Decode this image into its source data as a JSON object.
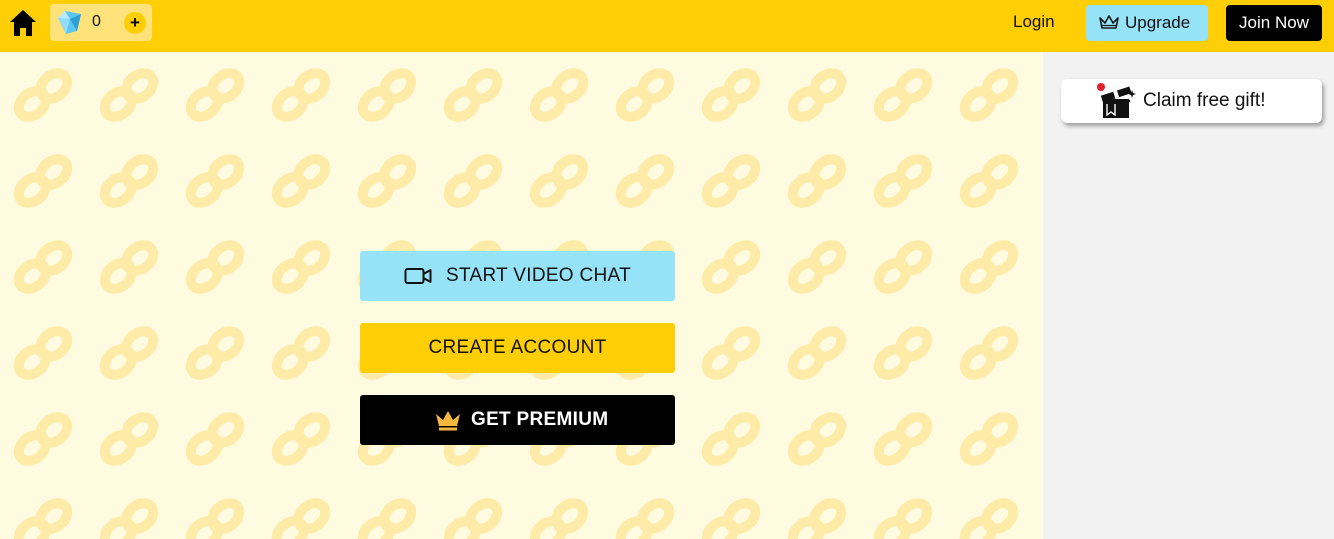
{
  "header": {
    "gem_count": "0",
    "plus_label": "+",
    "login_label": "Login",
    "upgrade_label": "Upgrade",
    "join_label": "Join Now"
  },
  "main": {
    "start_video_label": "START VIDEO CHAT",
    "create_account_label": "CREATE ACCOUNT",
    "premium_label": "GET PREMIUM"
  },
  "sidebar": {
    "gift_label": "Claim free gift!"
  },
  "icons": [
    "home-icon",
    "gem-icon",
    "plus-icon",
    "crown-icon",
    "video-camera-icon",
    "gift-icon",
    "mask-pattern"
  ],
  "colors": {
    "header_bg": "#ffce04",
    "stage_bg": "#fffbe0",
    "pattern": "#ffeba8",
    "video_button": "#96e3f8",
    "create_button": "#ffce04",
    "premium_button": "#000000",
    "crown_gold": "#f5b83d",
    "sidebar_bg": "#f2f2f2"
  }
}
